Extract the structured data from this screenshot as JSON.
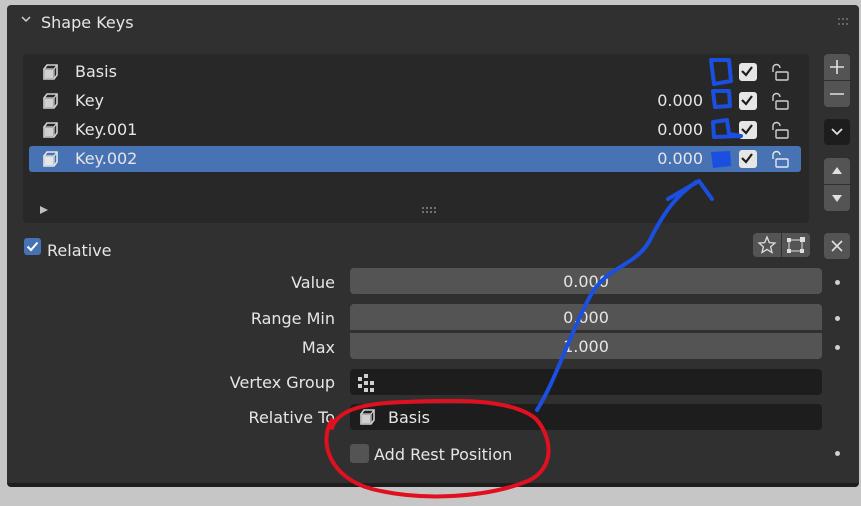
{
  "panel": {
    "title": "Shape Keys"
  },
  "shape_keys": [
    {
      "name": "Basis",
      "value": "",
      "selected": false,
      "muted": false
    },
    {
      "name": "Key",
      "value": "0.000",
      "selected": false,
      "muted": false
    },
    {
      "name": "Key.001",
      "value": "0.000",
      "selected": false,
      "muted": false
    },
    {
      "name": "Key.002",
      "value": "0.000",
      "selected": true,
      "muted": false
    }
  ],
  "relative": {
    "label": "Relative",
    "checked": true
  },
  "properties": {
    "value": {
      "label": "Value",
      "value": "0.000"
    },
    "range_min": {
      "label": "Range Min",
      "value": "0.000"
    },
    "max": {
      "label": "Max",
      "value": "1.000"
    },
    "vertex_group": {
      "label": "Vertex Group",
      "value": ""
    },
    "relative_to": {
      "label": "Relative To",
      "value": "Basis"
    },
    "add_rest_position": {
      "label": "Add Rest Position",
      "checked": false
    }
  },
  "colors": {
    "selection": "#4772b3",
    "panel_bg": "#303030",
    "annotation_blue": "#1a4fe0",
    "annotation_red": "#e01020"
  }
}
